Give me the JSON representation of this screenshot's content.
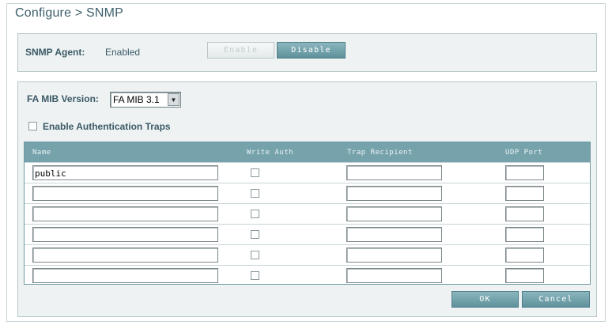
{
  "page": {
    "title": "Configure > SNMP"
  },
  "agent": {
    "label": "SNMP Agent:",
    "status": "Enabled",
    "enable_label": "Enable",
    "disable_label": "Disable"
  },
  "mib": {
    "label": "FA MIB Version:",
    "selected": "FA MIB 3.1"
  },
  "auth_traps": {
    "label": "Enable Authentication Traps",
    "checked": false
  },
  "table": {
    "headers": [
      "Name",
      "Write Auth",
      "Trap Recipient",
      "UDP Port"
    ],
    "rows": [
      {
        "name": "public",
        "write_auth": false,
        "trap_recipient": "",
        "udp_port": ""
      },
      {
        "name": "",
        "write_auth": false,
        "trap_recipient": "",
        "udp_port": ""
      },
      {
        "name": "",
        "write_auth": false,
        "trap_recipient": "",
        "udp_port": ""
      },
      {
        "name": "",
        "write_auth": false,
        "trap_recipient": "",
        "udp_port": ""
      },
      {
        "name": "",
        "write_auth": false,
        "trap_recipient": "",
        "udp_port": ""
      },
      {
        "name": "",
        "write_auth": false,
        "trap_recipient": "",
        "udp_port": ""
      }
    ]
  },
  "actions": {
    "ok_label": "OK",
    "cancel_label": "Cancel"
  },
  "colors": {
    "accent": "#76a3ab",
    "button": "#6f9fa8",
    "panel": "#eef2f3"
  },
  "icons": {
    "select_arrow": "chevron-down-icon"
  }
}
